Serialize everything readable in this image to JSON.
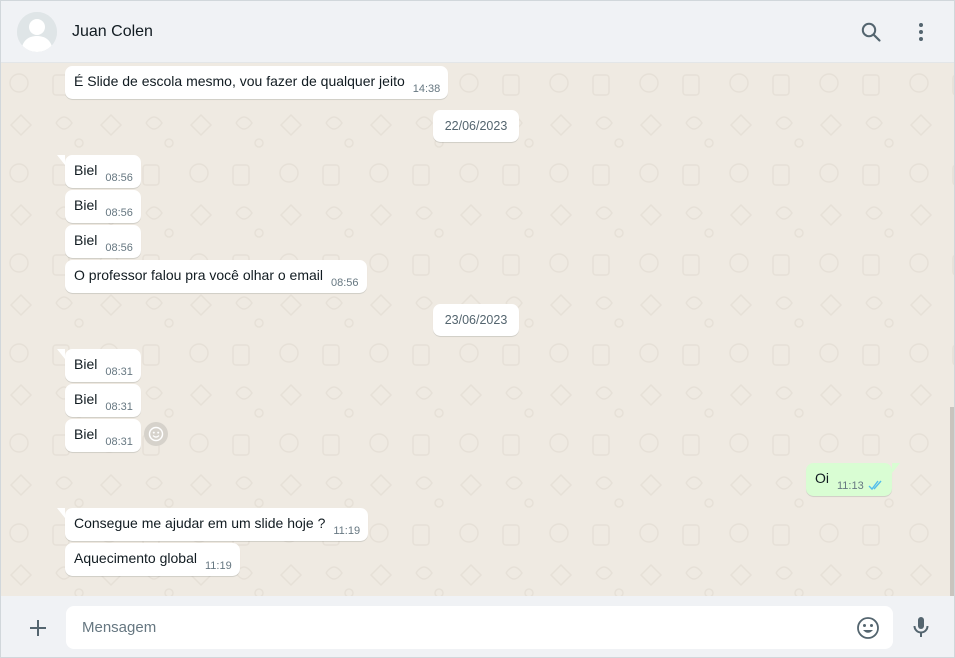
{
  "header": {
    "contact_name": "Juan Colen",
    "search_icon": "search-icon",
    "menu_icon": "more-vertical-icon"
  },
  "messages": [
    {
      "text": "É Slide de escola mesmo, vou fazer de qualquer jeito",
      "time": "14:38",
      "direction": "in"
    },
    {
      "date": "22/06/2023"
    },
    {
      "text": "Biel",
      "time": "08:56",
      "direction": "in"
    },
    {
      "text": "Biel",
      "time": "08:56",
      "direction": "in"
    },
    {
      "text": "Biel",
      "time": "08:56",
      "direction": "in"
    },
    {
      "text": "O professor falou pra você olhar o email",
      "time": "08:56",
      "direction": "in"
    },
    {
      "date": "23/06/2023"
    },
    {
      "text": "Biel",
      "time": "08:31",
      "direction": "in"
    },
    {
      "text": "Biel",
      "time": "08:31",
      "direction": "in"
    },
    {
      "text": "Biel",
      "time": "08:31",
      "direction": "in"
    },
    {
      "text": "Oi",
      "time": "11:13",
      "direction": "out",
      "status": "read"
    },
    {
      "text": "Consegue me ajudar em um slide hoje ?",
      "time": "11:19",
      "direction": "in"
    },
    {
      "text": "Aquecimento global",
      "time": "11:19",
      "direction": "in"
    }
  ],
  "composer": {
    "placeholder": "Mensagem",
    "value": ""
  },
  "colors": {
    "header_bg": "#f0f2f5",
    "chat_bg": "#efeae2",
    "incoming_bubble": "#ffffff",
    "outgoing_bubble": "#d9fdd3",
    "read_ticks": "#53bdeb",
    "time_text": "#667781"
  }
}
